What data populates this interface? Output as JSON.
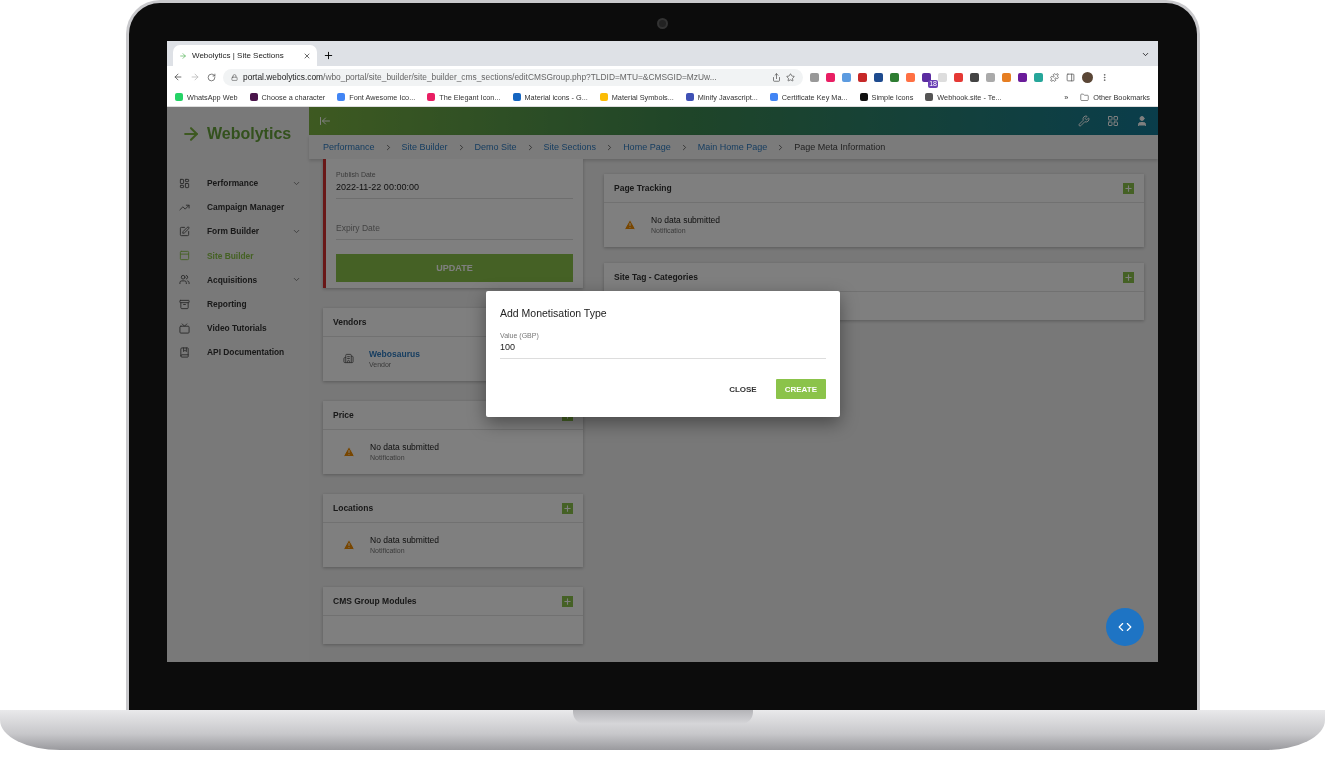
{
  "browser": {
    "tab_title": "Webolytics | Site Sections",
    "url_host": "portal.webolytics.com",
    "url_path": "/wbo_portal/site_builder/site_builder_cms_sections/editCMSGroup.php?TLDID=MTU=&CMSGID=MzUw...",
    "extension_badge": "18",
    "bookmarks": [
      "WhatsApp Web",
      "Choose a character",
      "Font Awesome Ico...",
      "The Elegant Icon...",
      "Material icons - G...",
      "Material Symbols...",
      "Minify Javascript...",
      "Certificate Key Ma...",
      "Simple Icons",
      "Webhook.site - Te..."
    ],
    "bookmarks_more": "»",
    "other_bookmarks": "Other Bookmarks"
  },
  "logo": "Webolytics",
  "sidebar": {
    "items": [
      {
        "label": "Performance",
        "selected": false,
        "expandable": true
      },
      {
        "label": "Campaign Manager",
        "selected": false,
        "expandable": false
      },
      {
        "label": "Form Builder",
        "selected": false,
        "expandable": true
      },
      {
        "label": "Site Builder",
        "selected": true,
        "expandable": false
      },
      {
        "label": "Acquisitions",
        "selected": false,
        "expandable": true
      },
      {
        "label": "Reporting",
        "selected": false,
        "expandable": false
      },
      {
        "label": "Video Tutorials",
        "selected": false,
        "expandable": false
      },
      {
        "label": "API Documentation",
        "selected": false,
        "expandable": false
      }
    ]
  },
  "breadcrumbs": [
    {
      "label": "Performance",
      "link": true
    },
    {
      "label": "Site Builder",
      "link": true
    },
    {
      "label": "Demo Site",
      "link": true
    },
    {
      "label": "Site Sections",
      "link": true
    },
    {
      "label": "Home Page",
      "link": true
    },
    {
      "label": "Main Home Page",
      "link": true
    },
    {
      "label": "Page Meta Information",
      "link": false
    }
  ],
  "date_card": {
    "publish_label": "Publish Date",
    "publish_value": "2022-11-22 00:00:00",
    "expiry_placeholder": "Expiry Date",
    "button": "UPDATE"
  },
  "left_cards": [
    {
      "title": "Vendors",
      "add": false,
      "item": {
        "kind": "vendor",
        "title": "Webosaurus",
        "subtitle": "Vendor"
      }
    },
    {
      "title": "Price",
      "add": true,
      "item": {
        "kind": "notice",
        "title": "No data submitted",
        "subtitle": "Notification"
      }
    },
    {
      "title": "Locations",
      "add": true,
      "item": {
        "kind": "notice",
        "title": "No data submitted",
        "subtitle": "Notification"
      }
    },
    {
      "title": "CMS Group Modules",
      "add": true
    }
  ],
  "right_cards": [
    {
      "title": "Page Tracking",
      "add": true,
      "item": {
        "kind": "notice",
        "title": "No data submitted",
        "subtitle": "Notification"
      }
    },
    {
      "title": "Site Tag - Categories",
      "add": true
    }
  ],
  "modal": {
    "title": "Add Monetisation Type",
    "field_label": "Value (GBP)",
    "field_value": "100",
    "buttons": [
      {
        "label": "CLOSE",
        "kind": "text"
      },
      {
        "label": "CREATE",
        "kind": "primary"
      }
    ]
  }
}
